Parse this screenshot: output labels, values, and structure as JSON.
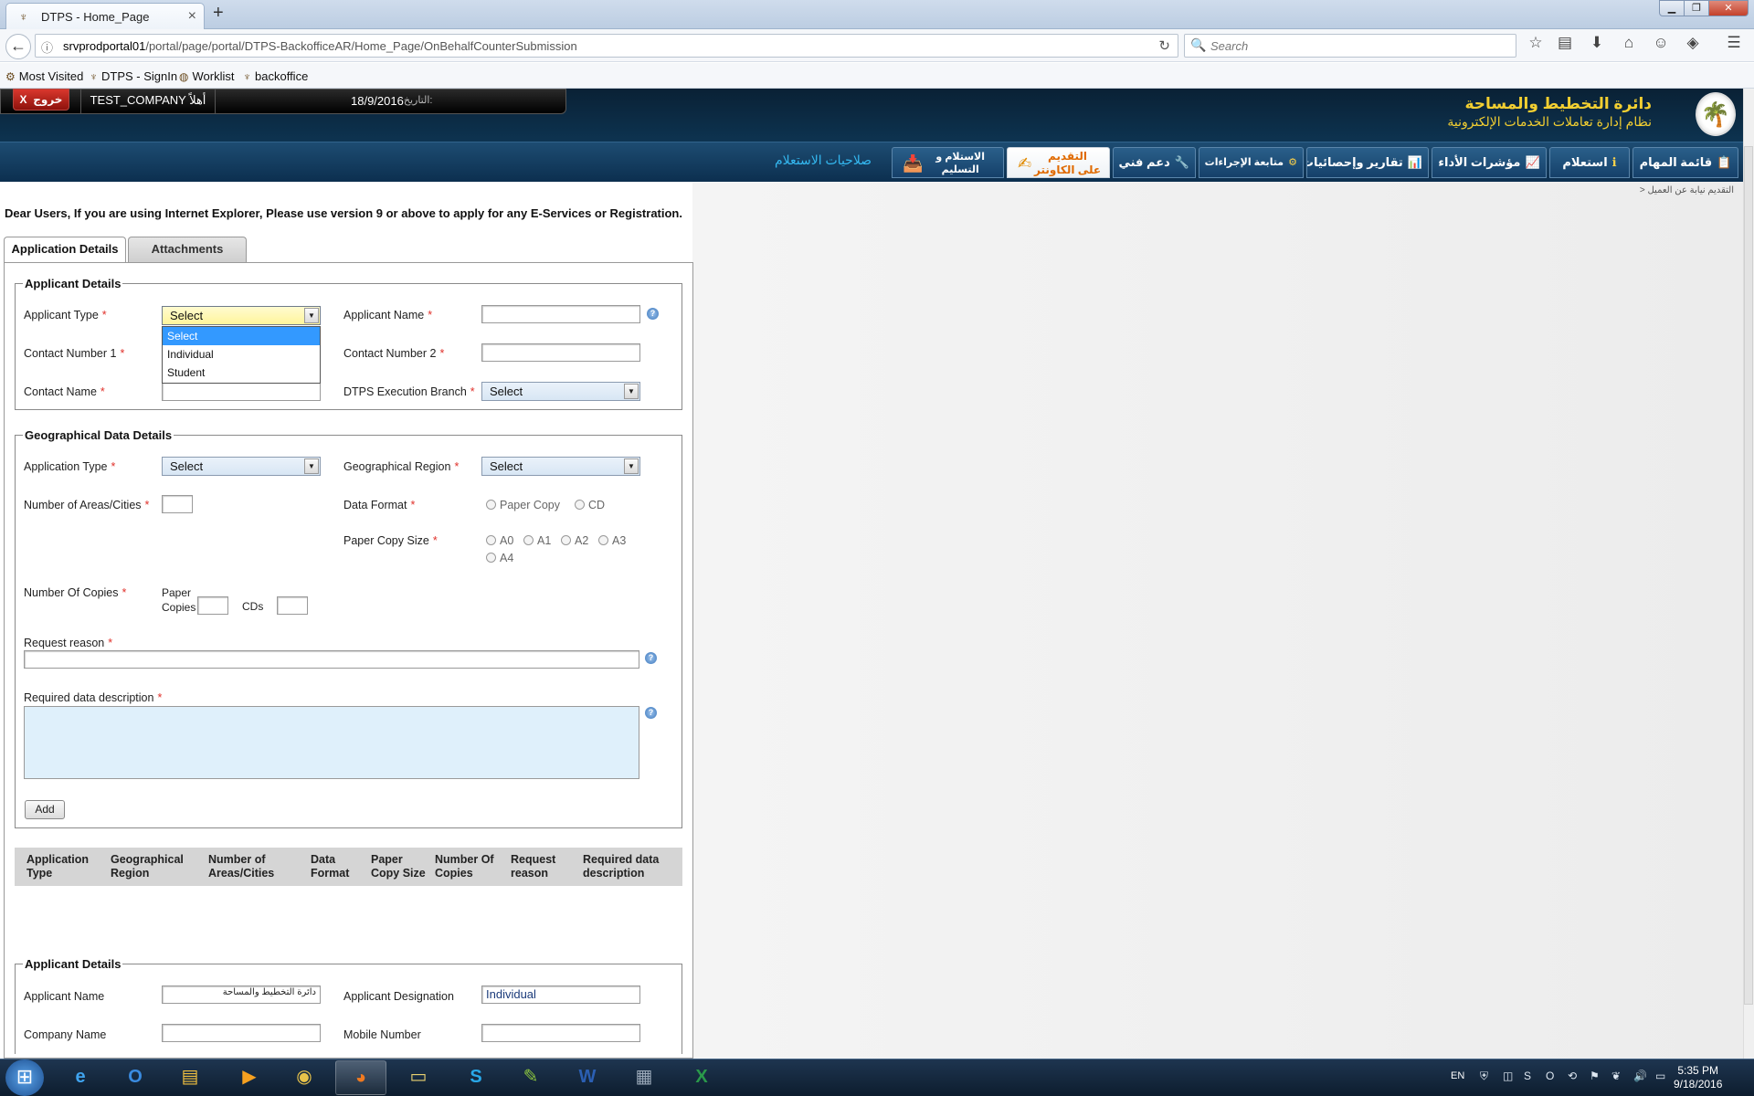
{
  "browser": {
    "tab_title": "DTPS - Home_Page",
    "new_tab": "+",
    "url_host": "srvprodportal01",
    "url_path": "/portal/page/portal/DTPS-BackofficeAR/Home_Page/OnBehalfCounterSubmission",
    "search_placeholder": "Search",
    "bookmarks": [
      "Most Visited",
      "DTPS - SignIn",
      "Worklist",
      "backoffice"
    ]
  },
  "header": {
    "logout_label": "خروج",
    "logout_x": "X",
    "welcome": "TEST_COMPANY أهلاً",
    "date_label": "التاريخ:",
    "date_value": "18/9/2016",
    "brand_title": "دائرة التخطيط والمساحة",
    "brand_subtitle": "نظام إدارة تعاملات الخدمات الإلكترونية"
  },
  "menu": {
    "items": [
      {
        "label": "قائمة المهام",
        "icon": "📋"
      },
      {
        "label": "استعلام",
        "icon": "ℹ"
      },
      {
        "label": "مؤشرات الأداء",
        "icon": "📈"
      },
      {
        "label": "تقارير وإحصائيات",
        "icon": "📊"
      },
      {
        "label": "متابعة الإجراءات",
        "icon": "⚙"
      },
      {
        "label": "دعم فني",
        "icon": "🔧"
      },
      {
        "label_line1": "التقديم",
        "label_line2": "على الكاونتر",
        "icon": "✍"
      },
      {
        "label_line1": "الاستلام و",
        "label_line2": "التسليم",
        "icon": "📥"
      }
    ],
    "permissions_link": "صلاحيات الاستعلام"
  },
  "breadcrumb": "التقديم نيابة عن العميل <",
  "notice": "Dear Users, If you are using Internet Explorer, Please use version 9 or above to apply for any E-Services or Registration.",
  "tabs": {
    "application_details": "Application Details",
    "attachments": "Attachments"
  },
  "applicant_details": {
    "legend": "Applicant Details",
    "applicant_type_label": "Applicant Type",
    "applicant_type_value": "Select",
    "applicant_type_options": [
      "Select",
      "Individual",
      "Student"
    ],
    "applicant_name_label": "Applicant Name",
    "contact1_label": "Contact Number 1",
    "contact2_label": "Contact Number 2",
    "contact_name_label": "Contact Name",
    "branch_label": "DTPS Execution Branch",
    "branch_value": "Select"
  },
  "geo": {
    "legend": "Geographical Data Details",
    "app_type_label": "Application Type",
    "app_type_value": "Select",
    "region_label": "Geographical Region",
    "region_value": "Select",
    "num_areas_label": "Number of Areas/Cities",
    "data_format_label": "Data Format",
    "data_format_options": [
      "Paper Copy",
      "CD"
    ],
    "paper_size_label": "Paper Copy Size",
    "paper_sizes": [
      "A0",
      "A1",
      "A2",
      "A3",
      "A4"
    ],
    "num_copies_label": "Number Of Copies",
    "paper_copies_line1": "Paper",
    "paper_copies_line2": "Copies",
    "cds_label": "CDs",
    "request_reason_label": "Request reason",
    "required_desc_label": "Required data description",
    "add_button": "Add"
  },
  "grid": {
    "columns": [
      {
        "l1": "Application",
        "l2": "Type"
      },
      {
        "l1": "Geographical",
        "l2": "Region"
      },
      {
        "l1": "Number of",
        "l2": "Areas/Cities"
      },
      {
        "l1": "Data",
        "l2": "Format"
      },
      {
        "l1": "Paper",
        "l2": "Copy Size"
      },
      {
        "l1": "Number Of",
        "l2": "Copies"
      },
      {
        "l1": "Request",
        "l2": "reason"
      },
      {
        "l1": "Required data",
        "l2": "description"
      }
    ]
  },
  "applicant_details_2": {
    "legend": "Applicant Details",
    "applicant_name_label": "Applicant Name",
    "applicant_name_value": "دائرة التخطيط والمساحة",
    "designation_label": "Applicant Designation",
    "designation_value": "Individual",
    "company_label": "Company Name",
    "mobile_label": "Mobile Number"
  },
  "taskbar": {
    "lang": "EN",
    "time": "5:35 PM",
    "date": "9/18/2016"
  }
}
